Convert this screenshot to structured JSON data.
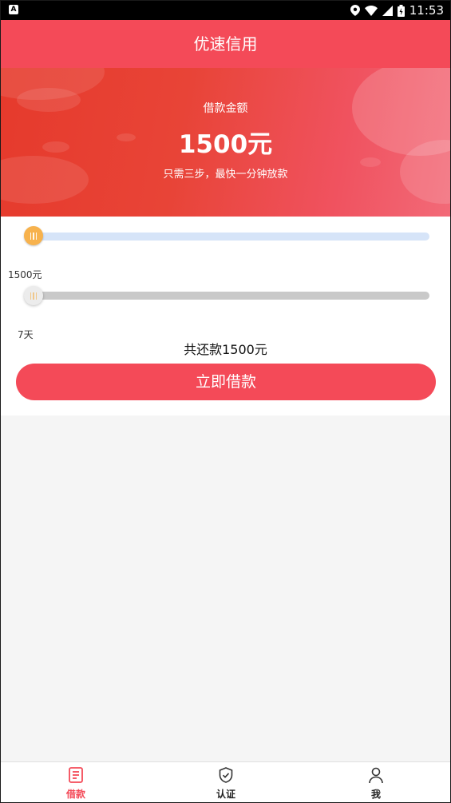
{
  "status_bar": {
    "left_icon": "A",
    "time": "11:53",
    "icons": [
      "location-icon",
      "wifi-icon",
      "signal-icon",
      "battery-icon"
    ]
  },
  "app_bar": {
    "title": "优速信用"
  },
  "banner": {
    "label": "借款金额",
    "amount": "1500元",
    "note": "只需三步，最快一分钟放款"
  },
  "sliders": {
    "amount": {
      "value_text": "1500元",
      "level": 0
    },
    "days": {
      "value_text": "7天",
      "level": 0
    }
  },
  "summary": {
    "total_text": "共还款1500元"
  },
  "actions": {
    "loan_button": "立即借款"
  },
  "bottom_nav": {
    "items": [
      {
        "label": "借款",
        "icon": "loan-document-icon",
        "active": true
      },
      {
        "label": "认证",
        "icon": "shield-check-icon",
        "active": false
      },
      {
        "label": "我",
        "icon": "user-icon",
        "active": false
      }
    ]
  },
  "colors": {
    "primary": "#f44a58",
    "banner_start": "#e63a2c",
    "slider_thumb": "#f7b24d",
    "slider_track_amount": "#d6e4f8",
    "slider_track_days": "#c9c9c9",
    "background": "#f5f5f5"
  }
}
